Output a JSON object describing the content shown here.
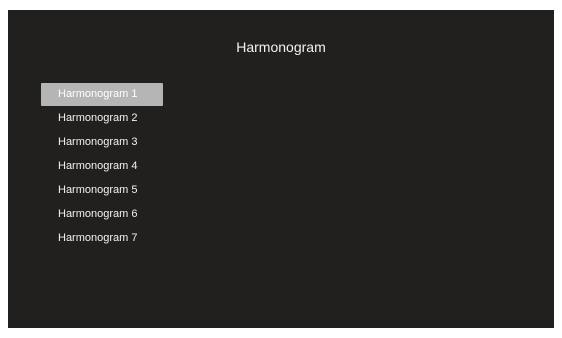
{
  "app": {
    "title": "Harmonogram"
  },
  "menu": {
    "selected_index": 0,
    "items": [
      {
        "label": "Harmonogram 1"
      },
      {
        "label": "Harmonogram 2"
      },
      {
        "label": "Harmonogram 3"
      },
      {
        "label": "Harmonogram 4"
      },
      {
        "label": "Harmonogram 5"
      },
      {
        "label": "Harmonogram 6"
      },
      {
        "label": "Harmonogram 7"
      }
    ]
  },
  "colors": {
    "background": "#221f1f",
    "text": "#f2f2f2",
    "selected_background": "#b5b5b5"
  }
}
